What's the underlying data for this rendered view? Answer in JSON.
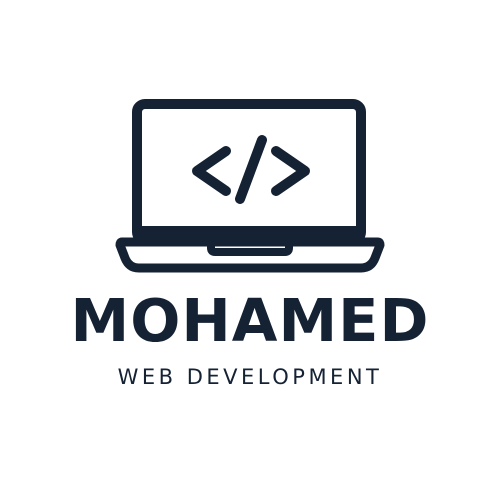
{
  "logo": {
    "icon": "laptop-code-icon",
    "brand_name": "MOHAMED",
    "tagline": "WEB DEVELOPMENT"
  },
  "colors": {
    "primary": "#142234",
    "background": "#ffffff"
  }
}
